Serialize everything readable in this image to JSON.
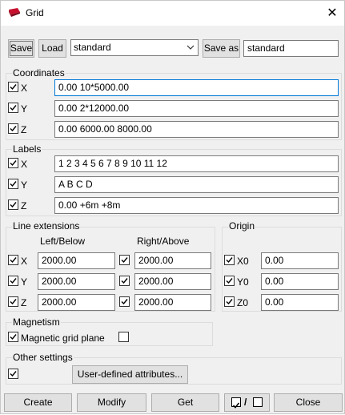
{
  "window": {
    "title": "Grid",
    "close_glyph": "✕",
    "icon": "grid-app-icon"
  },
  "toolbar": {
    "save_label": "Save",
    "load_label": "Load",
    "preset_selected": "standard",
    "save_as_label": "Save as",
    "save_as_value": "standard"
  },
  "coordinates": {
    "title": "Coordinates",
    "rows": [
      {
        "axis": "X",
        "checked": true,
        "value": "0.00 10*5000.00"
      },
      {
        "axis": "Y",
        "checked": true,
        "value": "0.00 2*12000.00"
      },
      {
        "axis": "Z",
        "checked": true,
        "value": "0.00 6000.00 8000.00"
      }
    ]
  },
  "labels": {
    "title": "Labels",
    "rows": [
      {
        "axis": "X",
        "checked": true,
        "value": "1 2 3 4 5 6 7 8 9 10 11 12"
      },
      {
        "axis": "Y",
        "checked": true,
        "value": "A B C D"
      },
      {
        "axis": "Z",
        "checked": true,
        "value": "0.00 +6m +8m"
      }
    ]
  },
  "line_extensions": {
    "title": "Line extensions",
    "left_header": "Left/Below",
    "right_header": "Right/Above",
    "rows": [
      {
        "axis": "X",
        "left": "2000.00",
        "right": "2000.00"
      },
      {
        "axis": "Y",
        "left": "2000.00",
        "right": "2000.00"
      },
      {
        "axis": "Z",
        "left": "2000.00",
        "right": "2000.00"
      }
    ]
  },
  "origin": {
    "title": "Origin",
    "rows": [
      {
        "axis": "X0",
        "value": "0.00"
      },
      {
        "axis": "Y0",
        "value": "0.00"
      },
      {
        "axis": "Z0",
        "value": "0.00"
      }
    ]
  },
  "magnetism": {
    "title": "Magnetism",
    "label": "Magnetic grid plane"
  },
  "other_settings": {
    "title": "Other settings",
    "uda_label": "User-defined attributes..."
  },
  "footer": {
    "create_label": "Create",
    "modify_label": "Modify",
    "get_label": "Get",
    "toggle_separator": "/",
    "close_label": "Close"
  }
}
